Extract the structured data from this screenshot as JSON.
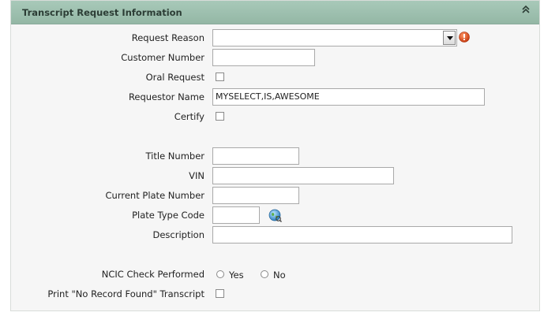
{
  "panel": {
    "title": "Transcript Request Information",
    "collapse_glyph": "⌃"
  },
  "form": {
    "request_reason": {
      "label": "Request Reason",
      "value": ""
    },
    "customer_number": {
      "label": "Customer Number",
      "value": ""
    },
    "oral_request": {
      "label": "Oral Request",
      "checked": false
    },
    "requestor_name": {
      "label": "Requestor Name",
      "value": "MYSELECT,IS,AWESOME"
    },
    "certify": {
      "label": "Certify",
      "checked": false
    },
    "title_number": {
      "label": "Title Number",
      "value": ""
    },
    "vin": {
      "label": "VIN",
      "value": ""
    },
    "current_plate_number": {
      "label": "Current Plate Number",
      "value": ""
    },
    "plate_type_code": {
      "label": "Plate Type Code",
      "value": ""
    },
    "description": {
      "label": "Description",
      "value": ""
    },
    "ncic_check": {
      "label": "NCIC Check Performed",
      "yes_label": "Yes",
      "no_label": "No"
    },
    "print_no_record": {
      "label": "Print \"No Record Found\" Transcript",
      "checked": false
    }
  },
  "icons": {
    "required": "exclamation-icon",
    "lookup": "globe-lookup-icon"
  },
  "colors": {
    "header_bg": "#a0c2b1",
    "panel_bg": "#f6f6f6",
    "required_icon": "#d9531e"
  }
}
